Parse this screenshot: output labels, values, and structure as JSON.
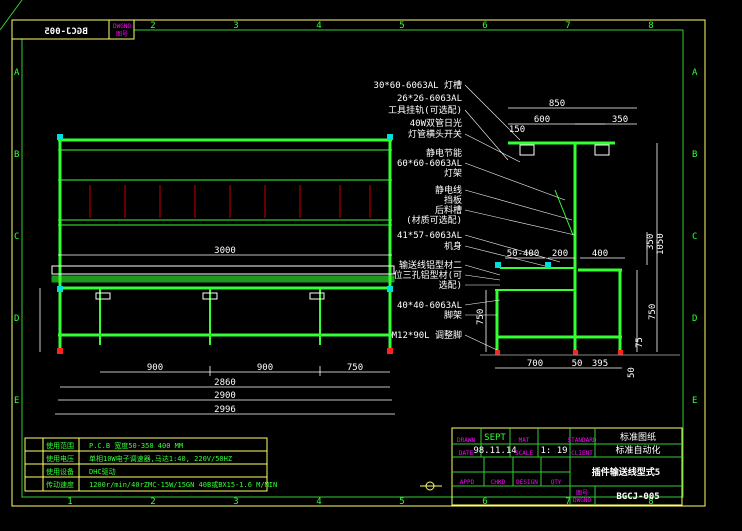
{
  "drawing_number": "BGCJ-005",
  "drawing_number_label": "DWGNO",
  "drawing_number_label_cn": "图号",
  "grid": {
    "columns": [
      "1",
      "2",
      "3",
      "4",
      "5",
      "6",
      "7",
      "8"
    ],
    "rows": [
      "A",
      "B",
      "C",
      "D",
      "E"
    ]
  },
  "front_view": {
    "dim_top": "3000",
    "dims_bottom": [
      "900",
      "900",
      "750"
    ],
    "dim_2860": "2860",
    "dim_2900": "2900",
    "dim_2996": "2996",
    "dim_750": "750"
  },
  "side_view": {
    "dims": {
      "d850": "850",
      "d600": "600",
      "d350a": "350",
      "d150": "150",
      "d50_400": "50-400",
      "d200": "200",
      "d400": "400",
      "d350b": "350",
      "d1050": "1050",
      "d750": "750",
      "d700": "700",
      "d50a": "50",
      "d395": "395",
      "d75": "75",
      "d50b": "50"
    },
    "callouts": [
      "30*60-6063AL 灯槽",
      "26*26-6063AL",
      "工具挂轨(可选配)",
      "40W双管日光",
      "灯管横头开关",
      "静电节能",
      "60*60-6063AL",
      "灯架",
      "静电线",
      "挡板",
      "后料槽",
      "(材质可选配)",
      "41*57-6063AL",
      "机身",
      "输送线铝型材二",
      "位三孔铝型材(可",
      "选配)",
      "40*40-6063AL",
      "脚架",
      "M12*90L 调整脚"
    ]
  },
  "spec_table": {
    "rows": [
      {
        "label": "使用范围",
        "value": "P.C.B 宽度50-350 400 MM"
      },
      {
        "label": "使用电压",
        "value": "单相10W电子调速器,马达1:40, 220V/50HZ"
      },
      {
        "label": "使用设备",
        "value": "DHC驱动"
      },
      {
        "label": "传动速度",
        "value": "1200r/min/40rZMC-15W/15GN 40B或BX15-1.6 M/MIN"
      }
    ]
  },
  "title_block": {
    "drawn_label": "DRAWN",
    "drawn_value": "SEPT",
    "mat_label": "MAT",
    "mat_value": "",
    "date_label": "DATE",
    "date_value": "98.11.14",
    "scale_label": "SCALE",
    "scale_value": "1: 19",
    "appd_label": "APPD",
    "chkd_label": "CHKD",
    "design_label": "DESIGN",
    "qty_label": "QTY",
    "std_label": "STANDARD",
    "std_value": "标准图纸",
    "client_label": "CLIENT",
    "client_value": "标准自动化",
    "title": "插件输送线型式5",
    "dwg_no": "BGCJ-005"
  },
  "colors": {
    "frame": "#ffff66",
    "structure": "#33ff33",
    "dimension": "#ffffff",
    "title_tag": "#ff00ff",
    "foot": "#ff2222",
    "joint": "#00dddd"
  }
}
